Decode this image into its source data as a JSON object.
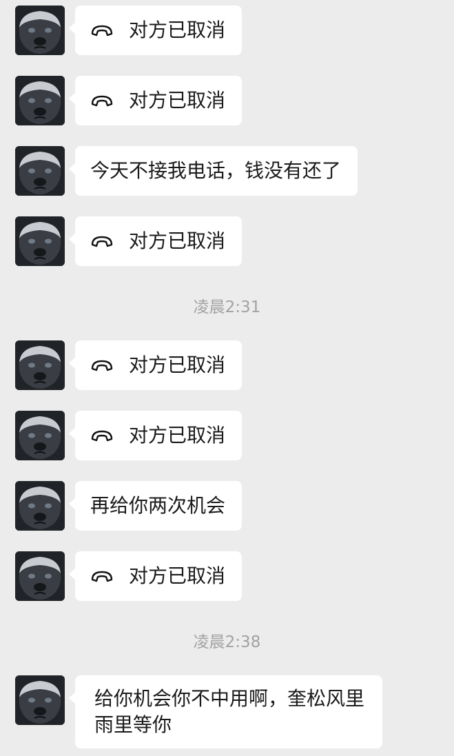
{
  "messages": [
    {
      "kind": "call",
      "text": "对方已取消"
    },
    {
      "kind": "call",
      "text": "对方已取消"
    },
    {
      "kind": "text",
      "text": "今天不接我电话，钱没有还了"
    },
    {
      "kind": "call",
      "text": "对方已取消"
    },
    {
      "kind": "time",
      "text": "凌晨2:31"
    },
    {
      "kind": "call",
      "text": "对方已取消"
    },
    {
      "kind": "call",
      "text": "对方已取消"
    },
    {
      "kind": "text",
      "text": "再给你两次机会"
    },
    {
      "kind": "call",
      "text": "对方已取消"
    },
    {
      "kind": "time",
      "text": "凌晨2:38"
    },
    {
      "kind": "text",
      "text": "给你机会你不中用啊，奎松风里雨里等你"
    }
  ],
  "icons": {
    "avatar": "honey-badger-avatar",
    "call": "hang-up-phone-icon"
  },
  "colors": {
    "background": "#ececec",
    "bubble": "#ffffff",
    "text": "#1a1a1a",
    "timestamp": "#a2a2a2"
  }
}
